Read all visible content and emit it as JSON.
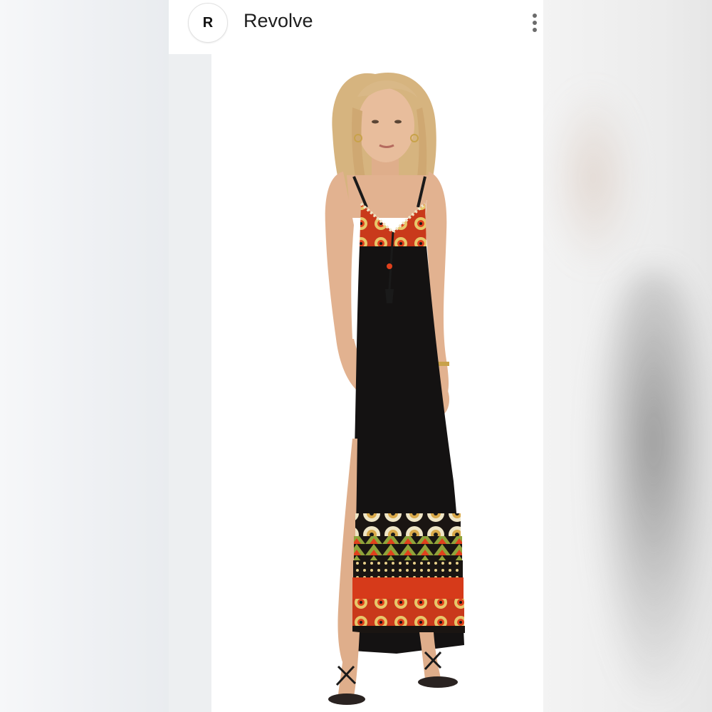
{
  "header": {
    "avatar_letter": "R",
    "seller_name": "Revolve"
  },
  "icons": {
    "menu": "more-vertical-icon"
  },
  "colors": {
    "dress_black": "#141212",
    "embroidery_red": "#e0401c",
    "embroidery_green": "#8fa33a",
    "skin": "#e2b290",
    "hair": "#d9b887"
  }
}
